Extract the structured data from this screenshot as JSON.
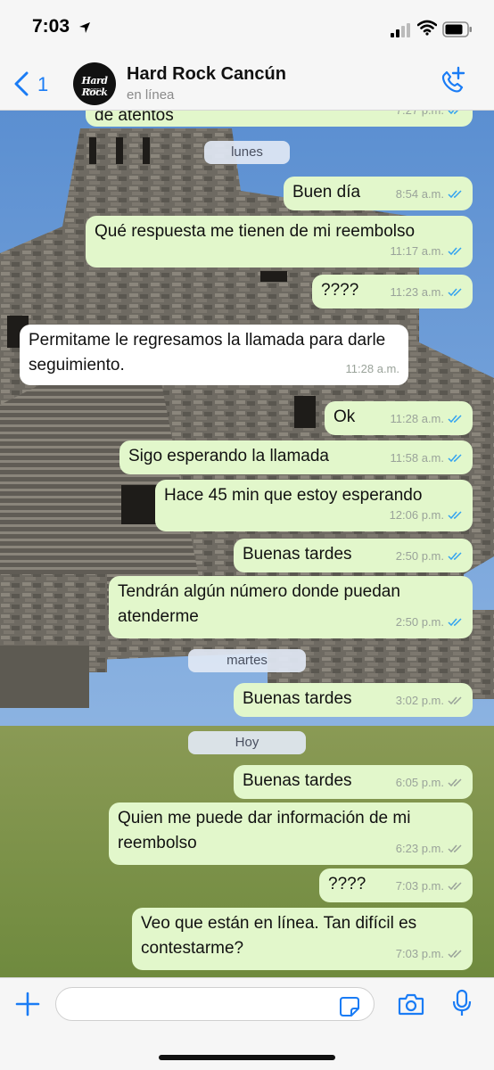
{
  "status_bar": {
    "time": "7:03"
  },
  "header": {
    "back_count": "1",
    "avatar_logo": "Hard Rock",
    "avatar_sub": "HOTEL",
    "contact_name": "Hard Rock Cancún",
    "contact_status": "en línea"
  },
  "messages": [
    {
      "dir": "out",
      "text": "de atentos",
      "time": "7:27 p.m.",
      "ticks": "blue"
    },
    {
      "dir": "out",
      "text": "Buen día",
      "time": "8:54 a.m.",
      "ticks": "blue"
    },
    {
      "dir": "out",
      "text": "Qué respuesta me tienen de mi reembolso",
      "time": "11:17 a.m.",
      "ticks": "blue"
    },
    {
      "dir": "out",
      "text": "????",
      "time": "11:23 a.m.",
      "ticks": "blue"
    },
    {
      "dir": "in",
      "text": "Permitame le regresamos la llamada para darle seguimiento.",
      "time": "11:28 a.m."
    },
    {
      "dir": "out",
      "text": "Ok",
      "time": "11:28 a.m.",
      "ticks": "blue"
    },
    {
      "dir": "out",
      "text": "Sigo esperando la llamada",
      "time": "11:58 a.m.",
      "ticks": "blue"
    },
    {
      "dir": "out",
      "text": "Hace 45 min que estoy esperando",
      "time": "12:06 p.m.",
      "ticks": "blue"
    },
    {
      "dir": "out",
      "text": "Buenas tardes",
      "time": "2:50 p.m.",
      "ticks": "blue"
    },
    {
      "dir": "out",
      "text": "Tendrán algún número donde puedan atenderme",
      "time": "2:50 p.m.",
      "ticks": "blue"
    },
    {
      "dir": "out",
      "text": "Buenas tardes",
      "time": "3:02 p.m.",
      "ticks": "grey"
    },
    {
      "dir": "out",
      "text": "Buenas tardes",
      "time": "6:05 p.m.",
      "ticks": "grey"
    },
    {
      "dir": "out",
      "text": "Quien me puede dar información de mi reembolso",
      "time": "6:23 p.m.",
      "ticks": "grey"
    },
    {
      "dir": "out",
      "text": "????",
      "time": "7:03 p.m.",
      "ticks": "grey"
    },
    {
      "dir": "out",
      "text": "Veo que están en línea. Tan difícil es contestarme?",
      "time": "7:03 p.m.",
      "ticks": "grey"
    }
  ],
  "date_separators": [
    "lunes",
    "martes",
    "Hoy"
  ],
  "icons": {
    "location": "location-arrow-icon",
    "signal": "cellular-signal-icon",
    "wifi": "wifi-icon",
    "battery": "battery-icon",
    "back": "chevron-left-icon",
    "call": "add-call-icon",
    "plus": "plus-icon",
    "sticker": "sticker-icon",
    "camera": "camera-icon",
    "mic": "microphone-icon"
  },
  "colors": {
    "accent": "#1a7cf5",
    "outgoing_bubble": "#e2f7cb",
    "incoming_bubble": "#ffffff",
    "read_tick": "#34a3f0",
    "sent_tick": "#9aa39a"
  }
}
